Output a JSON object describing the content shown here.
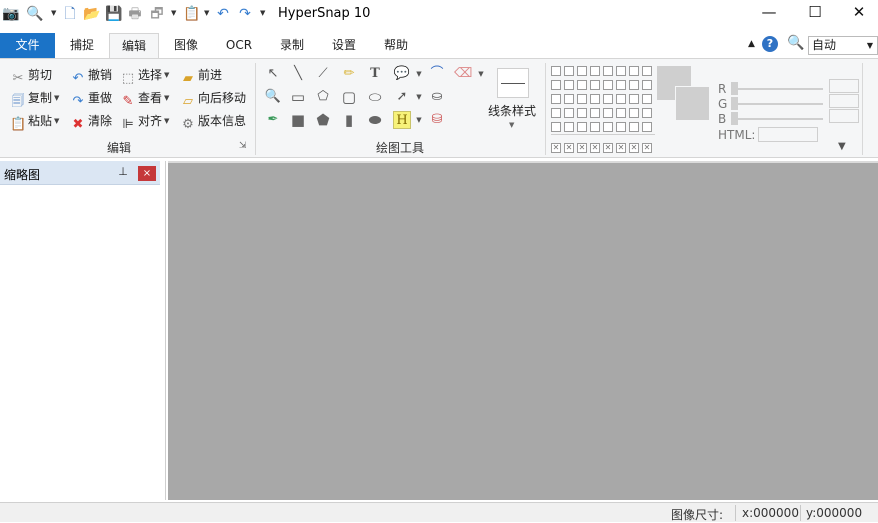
{
  "app": {
    "title": "HyperSnap 10"
  },
  "window_controls": {
    "minimize": "—",
    "maximize": "☐",
    "close": "✕"
  },
  "menu_tabs": [
    "文件",
    "捕捉",
    "编辑",
    "图像",
    "OCR",
    "录制",
    "设置",
    "帮助"
  ],
  "active_tab": "编辑",
  "zoom_select": {
    "value": "自动"
  },
  "ribbon": {
    "edit_group": {
      "label": "编辑",
      "items": {
        "cut": "剪切",
        "copy": "复制",
        "paste": "粘贴",
        "undo": "撤销",
        "redo": "重做",
        "clear": "清除",
        "select": "选择",
        "view": "查看",
        "align": "对齐",
        "forward": "前进",
        "move_back_forth": "向后移动",
        "version_info": "版本信息"
      }
    },
    "draw_group": {
      "label": "绘图工具",
      "line_style": "线条样式"
    },
    "color": {
      "r": "R",
      "g": "G",
      "b": "B",
      "html": "HTML:"
    },
    "colors": {
      "accent": "#1b73c7",
      "close_red": "#c5383a",
      "canvas": "#a8a8a8",
      "panel_header": "#dbe6f3"
    }
  },
  "thumbnail_panel": {
    "title": "缩略图",
    "pin": "📌",
    "close": "×"
  },
  "status": {
    "image_size_label": "图像尺寸:",
    "x": "x:000000",
    "y": "y:000000"
  }
}
